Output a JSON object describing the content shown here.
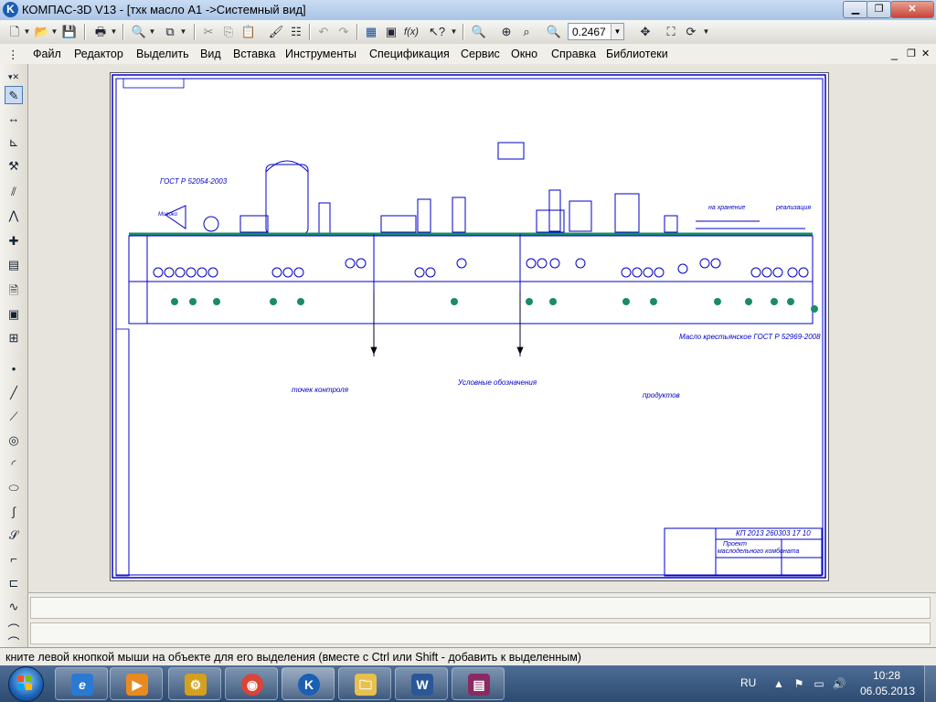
{
  "window": {
    "title": "КОМПАС-3D V13 - [тхк масло А1 ->Системный вид]",
    "app_icon": "kompas-logo-icon"
  },
  "window_buttons": {
    "minimize": "▁",
    "restore": "❐",
    "close": "✕"
  },
  "toolbar": {
    "zoom_value": "0.2467"
  },
  "menu": {
    "items": [
      {
        "label": "Файл"
      },
      {
        "label": "Редактор"
      },
      {
        "label": "Выделить"
      },
      {
        "label": "Вид"
      },
      {
        "label": "Вставка"
      },
      {
        "label": "Инструменты"
      },
      {
        "label": "Спецификация"
      },
      {
        "label": "Сервис"
      },
      {
        "label": "Окно"
      },
      {
        "label": "Справка"
      },
      {
        "label": "Библиотеки"
      }
    ],
    "doc_controls": {
      "minimize": "_",
      "restore": "❐",
      "close": "✕"
    }
  },
  "drawing": {
    "stamp_code": "КП 2013 260303 17 10",
    "gost_top": "ГОСТ Р 52054-2003",
    "product_note": "Масло крестьянское ГОСТ Р 52969-2008",
    "storage_label": "на хранение",
    "sale_label": "реализация",
    "legend_title": "Условные обозначения",
    "control_points": "точек контроля",
    "products_title": "продуктов",
    "stamp_title_1": "Проект",
    "stamp_title_2": "маслодельного комбината",
    "milk_label": "Молоко"
  },
  "status": {
    "message": "кните левой кнопкой мыши на объекте для его выделения (вместе с Ctrl или Shift - добавить к выделенным)"
  },
  "taskbar": {
    "language": "RU",
    "time": "10:28",
    "date": "06.05.2013"
  },
  "colors": {
    "drawing_blue": "#0000c8",
    "drawing_green": "#1a8a6a",
    "taskbar": "#2d4a70"
  }
}
